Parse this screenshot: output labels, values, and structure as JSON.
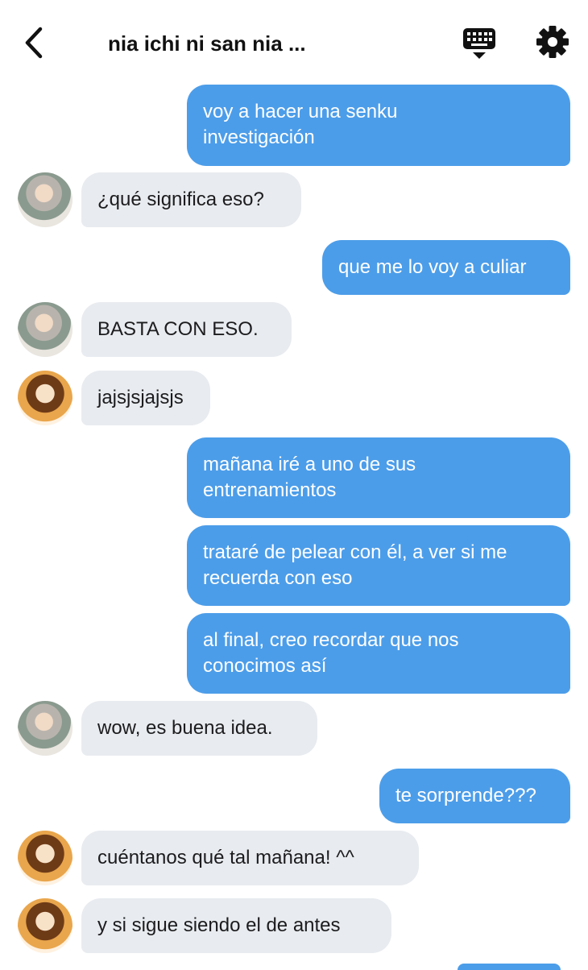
{
  "header": {
    "title": "nia ichi ni san nia ...",
    "icons": {
      "back": "back-chevron-icon",
      "keyboard": "keyboard-icon",
      "settings": "gear-icon"
    }
  },
  "colors": {
    "outgoing_bubble": "#4c9de9",
    "incoming_bubble": "#e8ebef",
    "background": "#ffffff"
  },
  "messages": [
    {
      "direction": "out",
      "text": "voy a hacer una senku\ninvestigación"
    },
    {
      "direction": "in",
      "avatar": "old-man-avatar",
      "text": "¿qué significa eso?"
    },
    {
      "direction": "out",
      "text": "que me lo voy a culiar"
    },
    {
      "direction": "in",
      "avatar": "old-man-avatar",
      "text": "BASTA CON ESO."
    },
    {
      "direction": "in",
      "avatar": "girl-avatar",
      "text": "jajsjsjajsjs"
    },
    {
      "direction": "out",
      "text": "mañana iré a uno de sus\nentrenamientos"
    },
    {
      "direction": "out",
      "text": "trataré de pelear con él, a ver si me\nrecuerda con eso"
    },
    {
      "direction": "out",
      "text": "al final, creo recordar que nos\nconocimos así"
    },
    {
      "direction": "in",
      "avatar": "old-man-avatar",
      "text": "wow, es buena idea."
    },
    {
      "direction": "out",
      "text": "te sorprende???"
    },
    {
      "direction": "in",
      "avatar": "girl-avatar",
      "text": " cuéntanos qué tal mañana! ^^"
    },
    {
      "direction": "in",
      "avatar": "girl-avatar",
      "text": "y si sigue siendo el de antes"
    }
  ]
}
